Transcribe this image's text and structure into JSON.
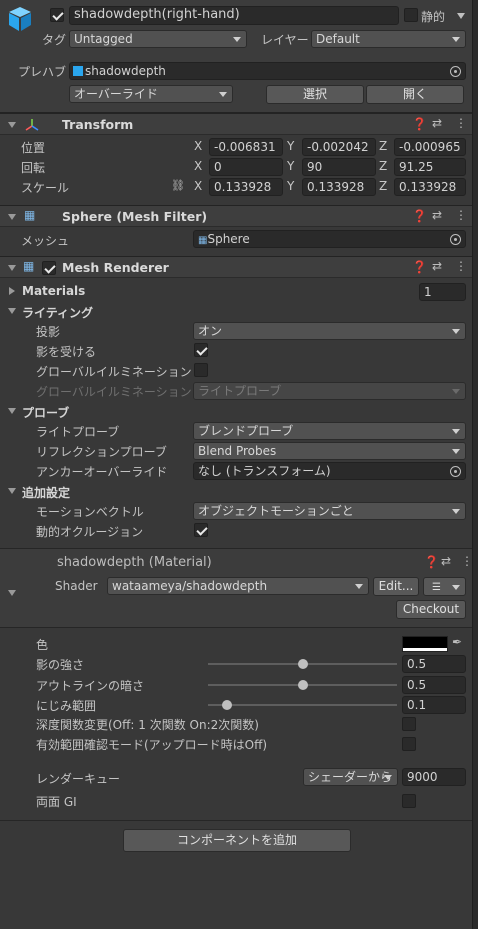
{
  "header": {
    "object_name": "shadowdepth(right-hand)",
    "static_label": "静的",
    "tag_label": "タグ",
    "tag_value": "Untagged",
    "layer_label": "レイヤー",
    "layer_value": "Default",
    "prefab_label": "プレハブ",
    "prefab_value": "shadowdepth",
    "override_label": "オーバーライド",
    "select_label": "選択",
    "open_label": "開く"
  },
  "transform": {
    "title": "Transform",
    "position_label": "位置",
    "rotation_label": "回転",
    "scale_label": "スケール",
    "position": {
      "x": "-0.006831",
      "y": "-0.002042",
      "z": "-0.000965"
    },
    "rotation": {
      "x": "0",
      "y": "90",
      "z": "91.25"
    },
    "scale": {
      "x": "0.133928",
      "y": "0.133928",
      "z": "0.133928"
    }
  },
  "mesh_filter": {
    "title": "Sphere (Mesh Filter)",
    "mesh_label": "メッシュ",
    "mesh_value": "Sphere"
  },
  "mesh_renderer": {
    "title": "Mesh Renderer",
    "materials_label": "Materials",
    "materials_count": "1",
    "lighting_label": "ライティング",
    "cast_shadows_label": "投影",
    "cast_shadows_value": "オン",
    "receive_shadows_label": "影を受ける",
    "gi_label": "グローバルイルミネーション",
    "gi_disabled_label": "グローバルイルミネーション",
    "gi_disabled_value": "ライトプローブ",
    "probes_label": "プローブ",
    "light_probes_label": "ライトプローブ",
    "light_probes_value": "ブレンドプローブ",
    "reflection_probes_label": "リフレクションプローブ",
    "reflection_probes_value": "Blend Probes",
    "anchor_override_label": "アンカーオーバーライド",
    "anchor_override_value": "なし (トランスフォーム)",
    "additional_label": "追加設定",
    "motion_vectors_label": "モーションベクトル",
    "motion_vectors_value": "オブジェクトモーションごと",
    "dynamic_occlusion_label": "動的オクルージョン"
  },
  "material": {
    "title": "shadowdepth (Material)",
    "shader_label": "Shader",
    "shader_value": "wataameya/shadowdepth",
    "edit_label": "Edit...",
    "checkout_label": "Checkout",
    "color_label": "色",
    "shadow_strength_label": "影の強さ",
    "shadow_strength_value": "0.5",
    "outline_dark_label": "アウトラインの暗さ",
    "outline_dark_value": "0.5",
    "blur_label": "にじみ範囲",
    "blur_value": "0.1",
    "depth_func_label": "深度関数変更(Off: 1 次関数 On:2次関数)",
    "range_check_label": "有効範囲確認モード(アップロード時はOff)",
    "render_queue_label": "レンダーキュー",
    "render_queue_mode": "シェーダーから",
    "render_queue_value": "9000",
    "double_gi_label": "両面 GI"
  },
  "footer": {
    "add_component_label": "コンポーネントを追加"
  },
  "xyz": {
    "x": "X",
    "y": "Y",
    "z": "Z"
  },
  "sliders": {
    "shadow_strength": 0.5,
    "outline_dark": 0.5,
    "blur": 0.1
  }
}
